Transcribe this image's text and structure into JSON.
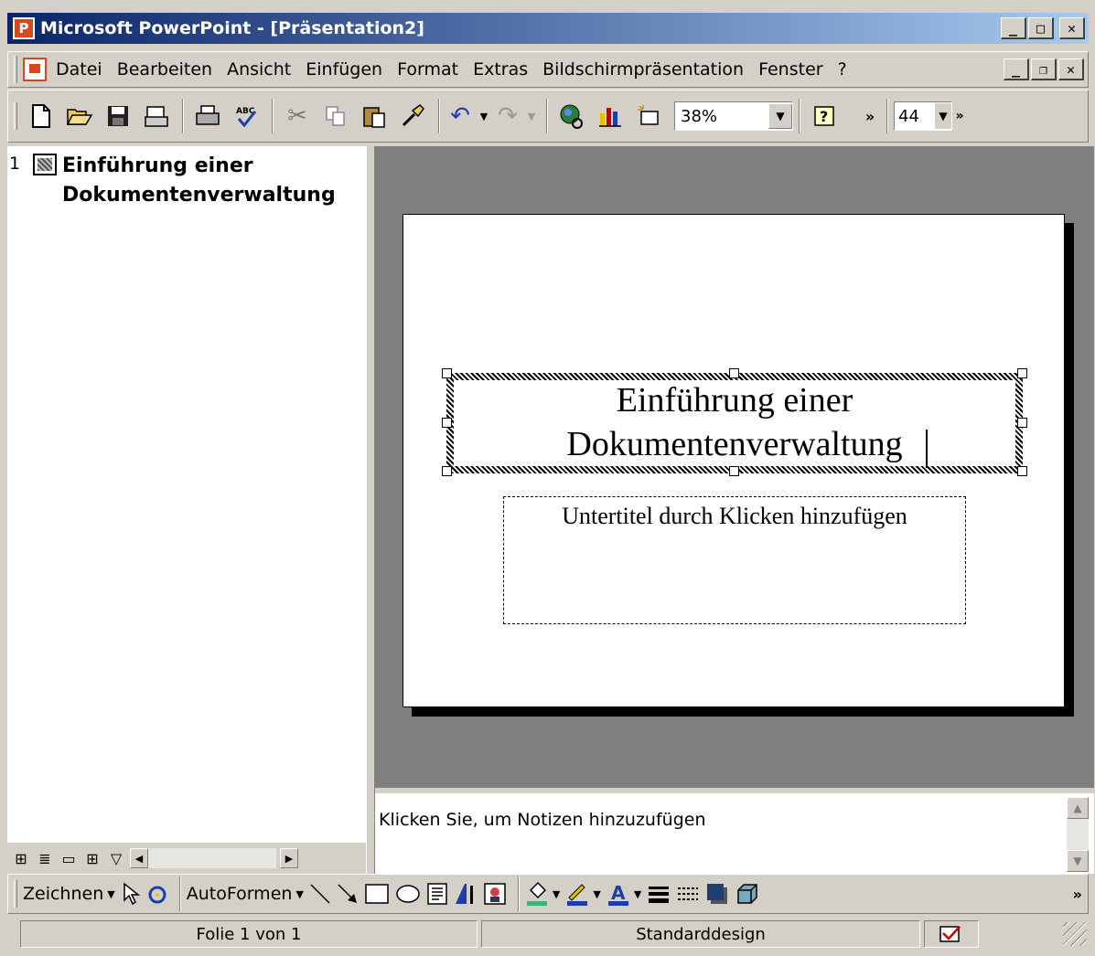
{
  "window": {
    "title": "Microsoft PowerPoint - [Präsentation2]",
    "icon": "powerpoint-app-icon",
    "controls": {
      "minimize": "_",
      "maximize": "□",
      "close": "✕"
    }
  },
  "menubar": {
    "items": [
      "Datei",
      "Bearbeiten",
      "Ansicht",
      "Einfügen",
      "Format",
      "Extras",
      "Bildschirmpräsentation",
      "Fenster",
      "?"
    ],
    "doc_controls": {
      "minimize": "_",
      "restore": "❐",
      "close": "✕"
    }
  },
  "toolbar": {
    "zoom": "38%",
    "font_size": "44",
    "more": "»",
    "icons": [
      "new-icon",
      "open-icon",
      "save-icon",
      "email-icon",
      "print-icon",
      "spellcheck-icon",
      "cut-icon",
      "copy-icon",
      "paste-icon",
      "format-painter-icon",
      "undo-icon",
      "redo-icon",
      "hyperlink-icon",
      "chart-icon",
      "new-slide-icon",
      "help-icon"
    ]
  },
  "outline": {
    "slide_number": "1",
    "title": "Einführung einer Dokumentenverwaltung"
  },
  "slide": {
    "title_line1": "Einführung einer",
    "title_line2": "Dokumentenverwaltung",
    "subtitle_placeholder": "Untertitel durch Klicken hinzufügen"
  },
  "notes": {
    "placeholder": "Klicken Sie, um Notizen hinzuzufügen"
  },
  "drawbar": {
    "draw_label": "Zeichnen",
    "autoshapes_label": "AutoFormen",
    "more": "»"
  },
  "statusbar": {
    "slide_info": "Folie 1 von 1",
    "design": "Standarddesign"
  },
  "colors": {
    "titlebar_start": "#0a246a",
    "titlebar_end": "#a6caf0",
    "workspace": "#808080",
    "chrome": "#d4d0c8",
    "powerpoint_red": "#d9481d"
  }
}
